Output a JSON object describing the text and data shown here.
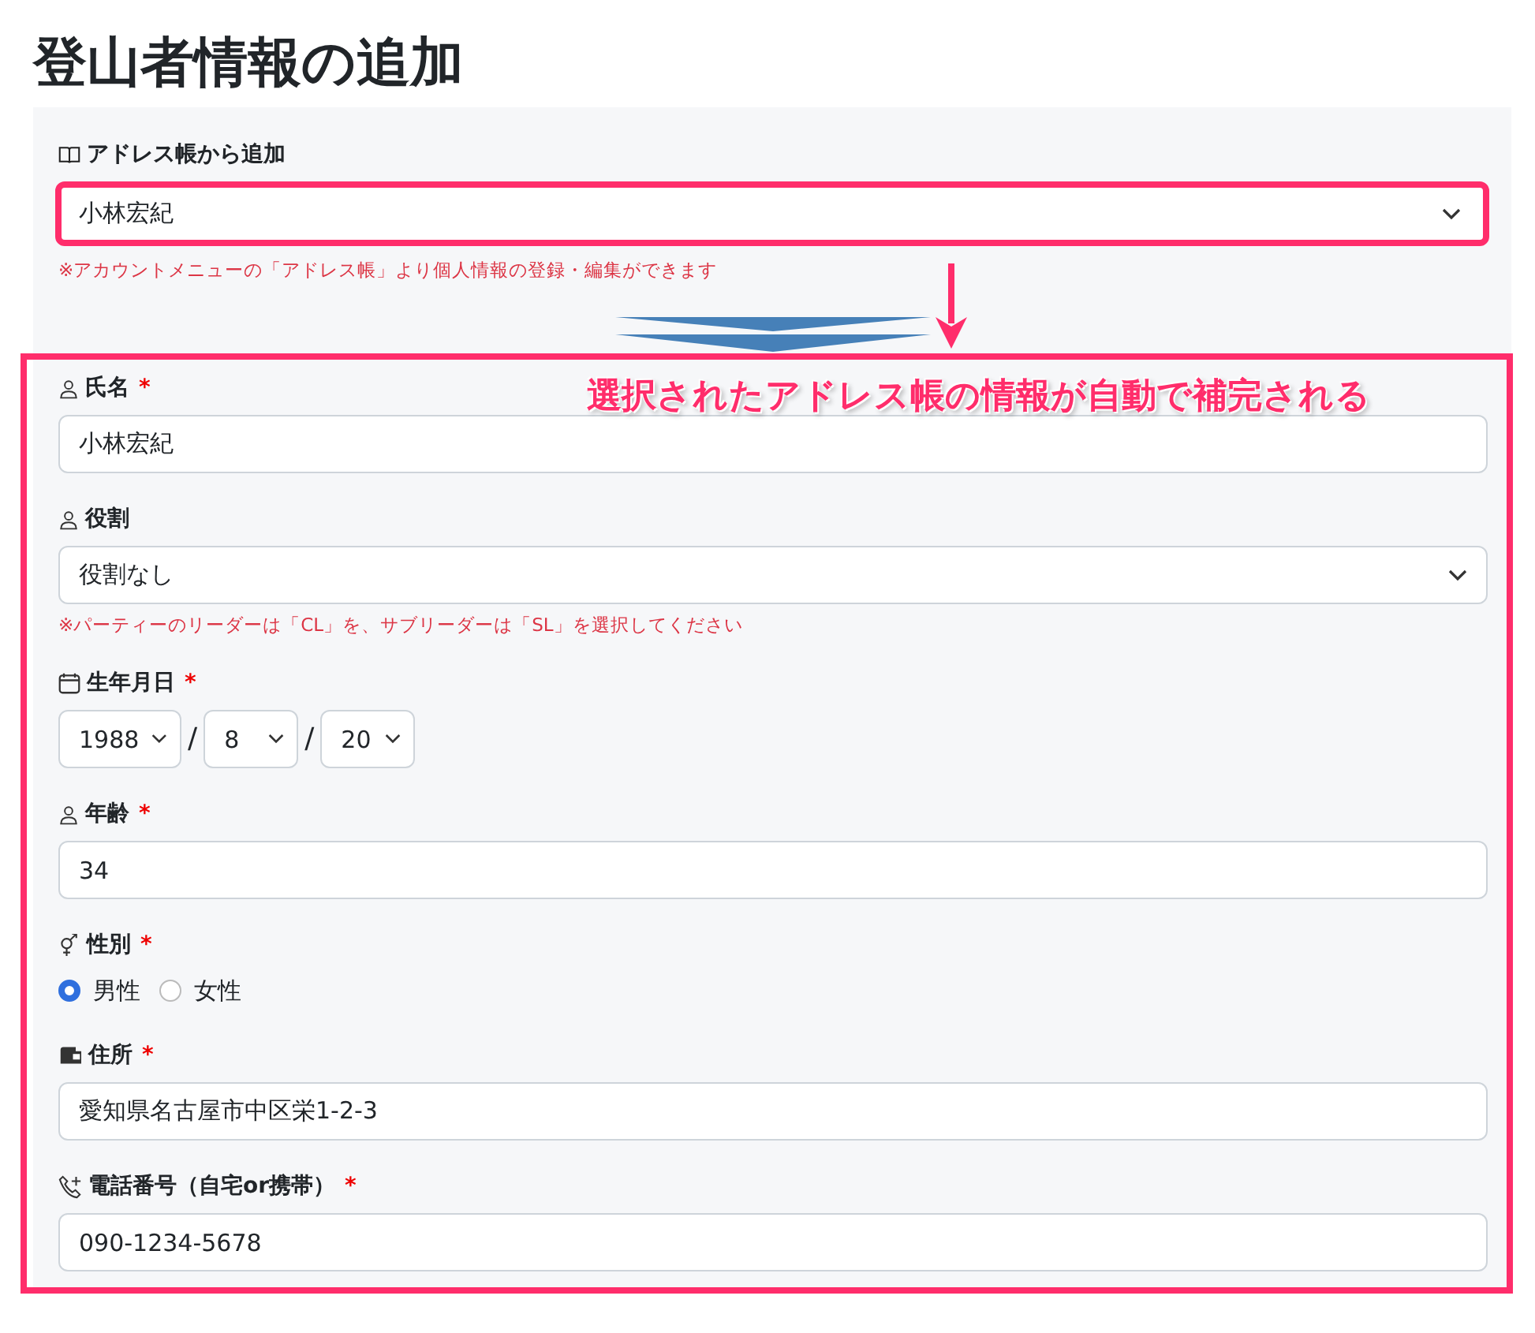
{
  "title": "登山者情報の追加",
  "address_book": {
    "label": "アドレス帳から追加",
    "value": "小林宏紀",
    "note": "※アカウントメニューの「アドレス帳」より個人情報の登録・編集ができます"
  },
  "callout": "選択されたアドレス帳の情報が自動で補完される",
  "fields": [
    {
      "kind": "input",
      "label": "氏名",
      "required_mark": "*",
      "value": "小林宏紀"
    },
    {
      "kind": "select",
      "label": "役割",
      "value": "役割なし",
      "note": "※パーティーのリーダーは「CL」を、サブリーダーは「SL」を選択してください"
    },
    {
      "kind": "date",
      "label": "生年月日",
      "required_mark": "*",
      "parts": [
        "1988",
        "8",
        "20"
      ],
      "separators": [
        "/",
        "/"
      ]
    },
    {
      "kind": "input",
      "label": "年齢",
      "required_mark": "*",
      "value": "34"
    },
    {
      "kind": "radio",
      "label": "性別",
      "required_mark": "*",
      "options": [
        {
          "label": "男性",
          "selected": true
        },
        {
          "label": "女性",
          "selected": false
        }
      ]
    },
    {
      "kind": "input",
      "label": "住所",
      "required_mark": "*",
      "value": "愛知県名古屋市中区栄1-2-3"
    },
    {
      "kind": "input",
      "label": "電話番号（自宅or携帯）",
      "required_mark": "*",
      "value": "090-1234-5678"
    }
  ]
}
